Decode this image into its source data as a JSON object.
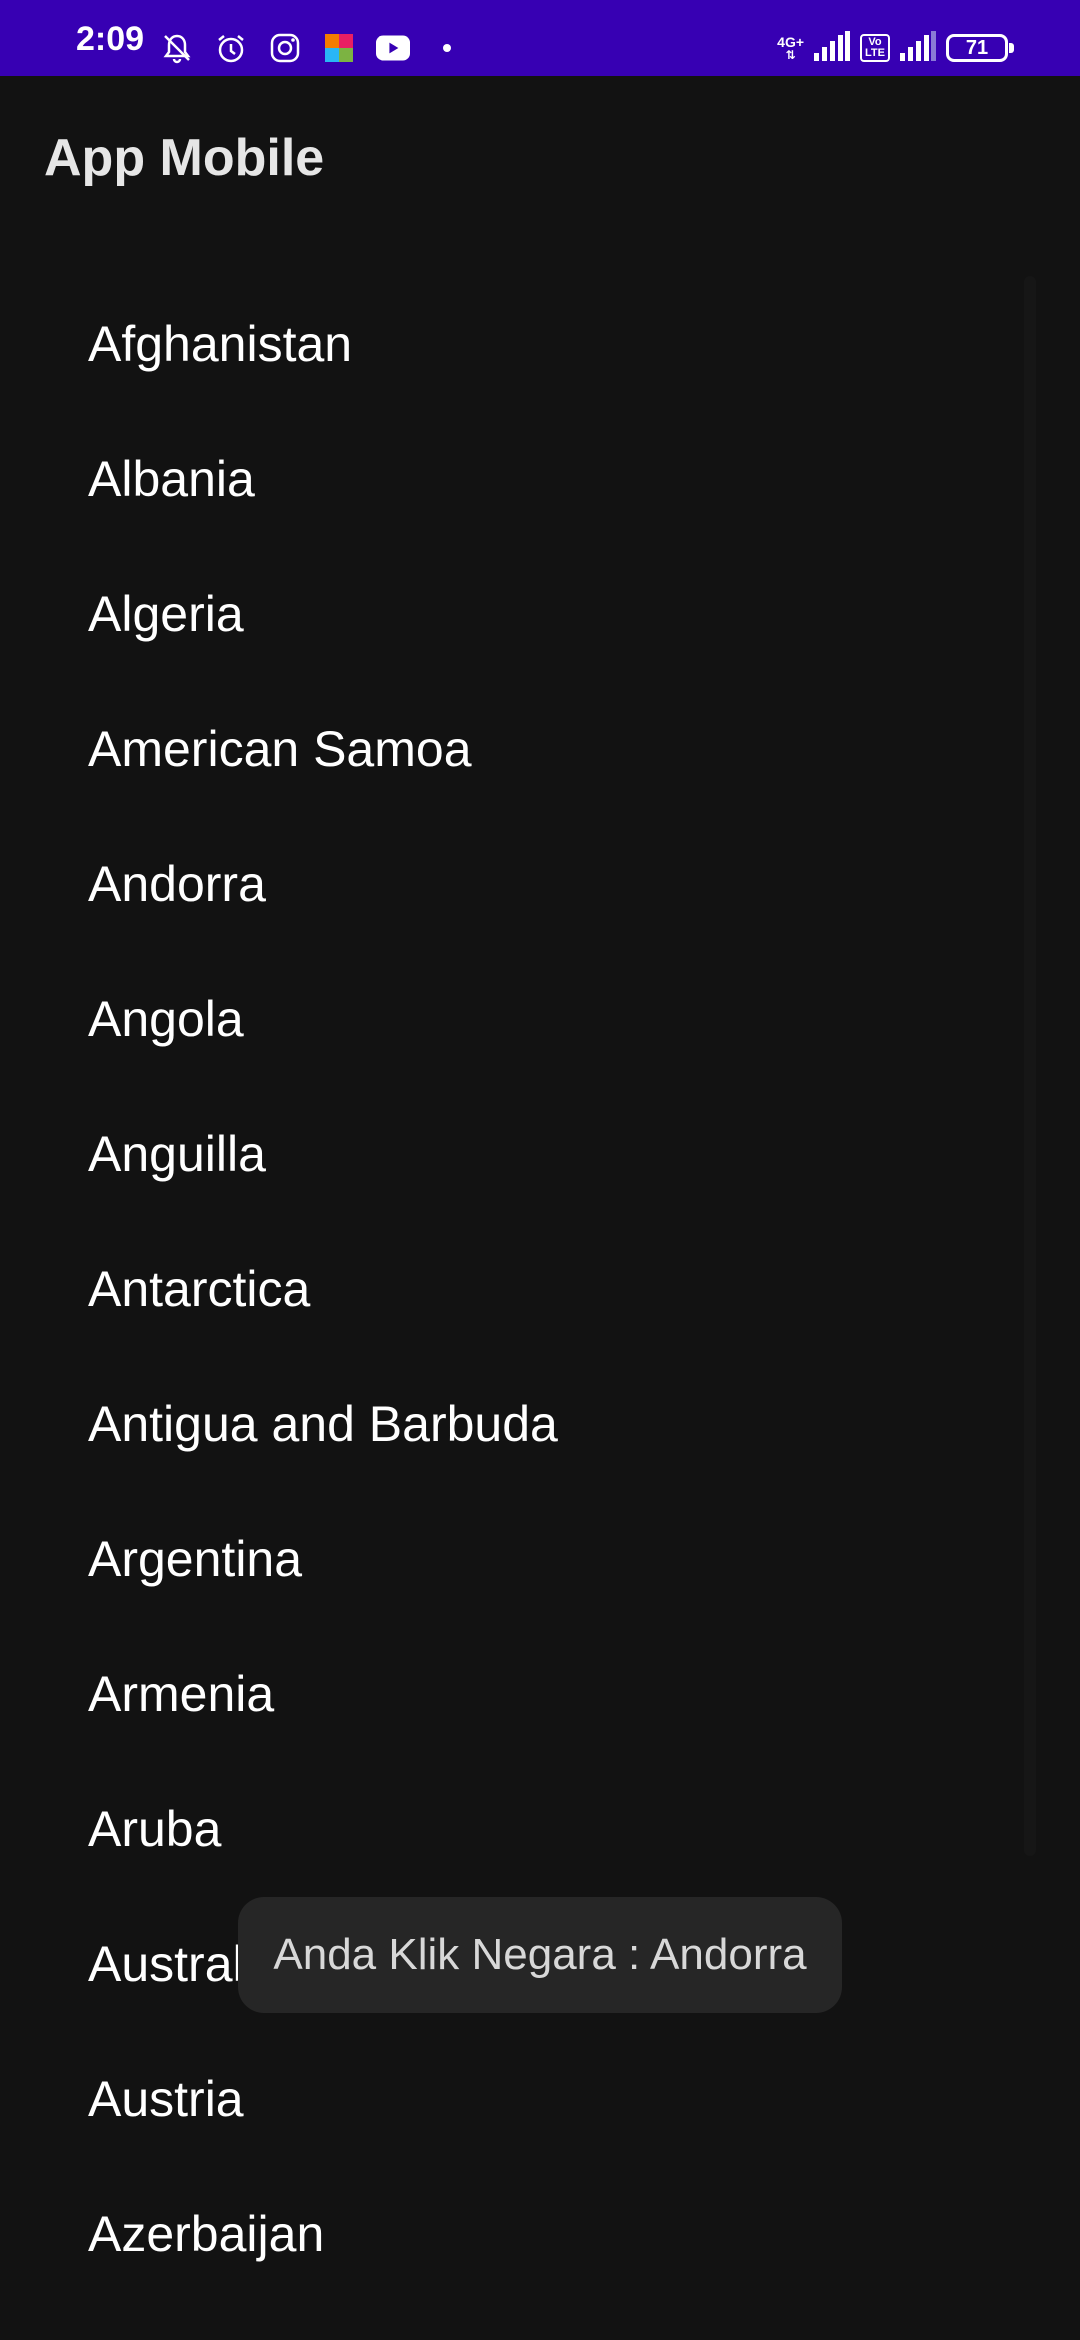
{
  "status_bar": {
    "time": "2:09",
    "network_type": "4G+",
    "volte_top": "Vo",
    "volte_bottom": "LTE",
    "battery_level": "71",
    "background_color": "#3700B3",
    "icons": [
      "bell-off-icon",
      "alarm-icon",
      "instagram-icon",
      "photos-app-icon",
      "youtube-icon",
      "notification-dot-icon",
      "signal-icon",
      "volte-icon",
      "signal-icon",
      "battery-icon"
    ]
  },
  "app_bar": {
    "title": "App Mobile"
  },
  "countries": {
    "items": [
      {
        "label": "Afghanistan"
      },
      {
        "label": "Albania"
      },
      {
        "label": "Algeria"
      },
      {
        "label": "American Samoa"
      },
      {
        "label": "Andorra"
      },
      {
        "label": "Angola"
      },
      {
        "label": "Anguilla"
      },
      {
        "label": "Antarctica"
      },
      {
        "label": "Antigua and Barbuda"
      },
      {
        "label": "Argentina"
      },
      {
        "label": "Armenia"
      },
      {
        "label": "Aruba"
      },
      {
        "label": "Australia"
      },
      {
        "label": "Austria"
      },
      {
        "label": "Azerbaijan"
      }
    ]
  },
  "toast": {
    "message": "Anda Klik Negara : Andorra"
  }
}
